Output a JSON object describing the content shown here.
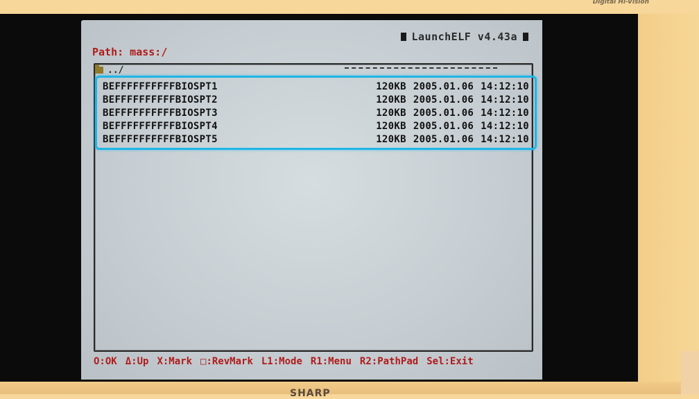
{
  "monitor": {
    "label": "Digital Hi-Vision",
    "brand": "SHARP"
  },
  "app": {
    "title": "LaunchELF v4.43a",
    "path": "Path: mass:/"
  },
  "folder_row": {
    "label": "../"
  },
  "files": [
    {
      "name": "BEFFFFFFFFFFBIOSPT1",
      "size": "120KB",
      "date": "2005.01.06",
      "time": "14:12:10"
    },
    {
      "name": "BEFFFFFFFFFFBIOSPT2",
      "size": "120KB",
      "date": "2005.01.06",
      "time": "14:12:10"
    },
    {
      "name": "BEFFFFFFFFFFBIOSPT3",
      "size": "120KB",
      "date": "2005.01.06",
      "time": "14:12:10"
    },
    {
      "name": "BEFFFFFFFFFFBIOSPT4",
      "size": "120KB",
      "date": "2005.01.06",
      "time": "14:12:10"
    },
    {
      "name": "BEFFFFFFFFFFBIOSPT5",
      "size": "120KB",
      "date": "2005.01.06",
      "time": "14:12:10"
    }
  ],
  "footer": {
    "ok": "O:OK",
    "up": "Δ:Up",
    "mark": "X:Mark",
    "revmark": "□:RevMark",
    "mode": "L1:Mode",
    "menu": "R1:Menu",
    "pathpad": "R2:PathPad",
    "exit": "Sel:Exit"
  },
  "colors": {
    "highlight": "#1fb5e6",
    "path_text": "#b01b1b",
    "footer_text": "#b01b1b",
    "screen_bg": "#c9d1d5"
  }
}
